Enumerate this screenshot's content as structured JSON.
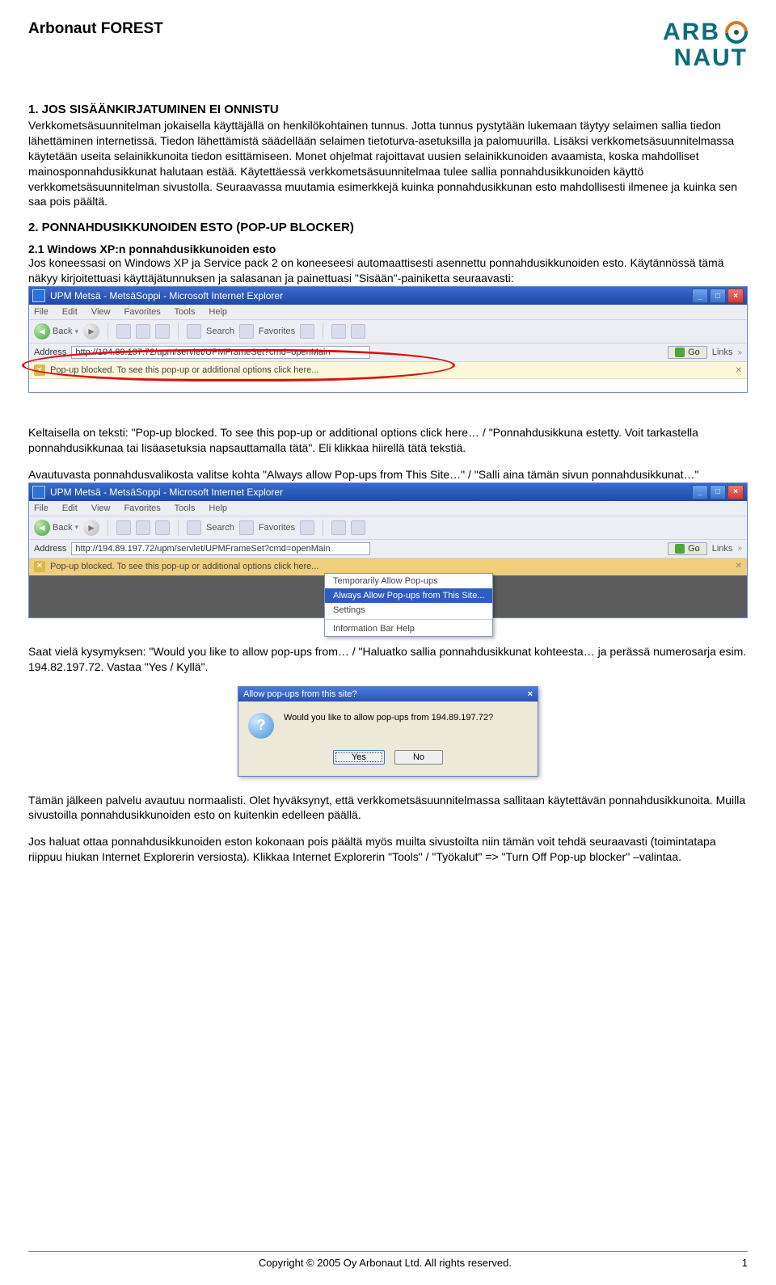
{
  "header": {
    "doc_title": "Arbonaut FOREST",
    "logo_top": "ARB",
    "logo_bottom": "NAUT"
  },
  "section1": {
    "title": "1. JOS SISÄÄNKIRJATUMINEN EI ONNISTU",
    "body": "Verkkometsäsuunnitelman jokaisella käyttäjällä on henkilökohtainen tunnus. Jotta tunnus pystytään lukemaan täytyy selaimen sallia tiedon lähettäminen internetissä. Tiedon lähettämistä säädellään selaimen tietoturva-asetuksilla ja palomuurilla. Lisäksi verkkometsäsuunnitelmassa käytetään useita selainikkunoita tiedon esittämiseen. Monet ohjelmat rajoittavat uusien selainikkunoiden avaamista, koska mahdolliset mainosponnahdusikkunat halutaan estää. Käytettäessä verkkometsäsuunnitelmaa tulee sallia ponnahdusikkunoiden käyttö verkkometsäsuunnitelman sivustolla. Seuraavassa muutamia esimerkkejä kuinka ponnahdusikkunan esto mahdollisesti ilmenee ja kuinka sen saa pois päältä."
  },
  "section2": {
    "title": "2. PONNAHDUSIKKUNOIDEN ESTO (POP-UP BLOCKER)",
    "sub_title": "2.1 Windows XP:n ponnahdusikkunoiden esto",
    "body": "Jos koneessasi on Windows XP ja Service pack 2 on koneeseesi automaattisesti asennettu ponnahdusikkunoiden esto. Käytännössä tämä näkyy kirjoitettuasi käyttäjätunnuksen ja salasanan ja painettuasi \"Sisään\"-painiketta seuraavasti:"
  },
  "ie_common": {
    "title": "UPM Metsä - MetsäSoppi - Microsoft Internet Explorer",
    "menu": {
      "file": "File",
      "edit": "Edit",
      "view": "View",
      "fav": "Favorites",
      "tools": "Tools",
      "help": "Help"
    },
    "toolbar": {
      "back": "Back",
      "search": "Search",
      "favorites": "Favorites"
    },
    "address_label": "Address",
    "url": "http://194.89.197.72/upm/servlet/UPMFrameSet?cmd=openMain",
    "go": "Go",
    "links": "Links",
    "popup_text": "Pop-up blocked. To see this pop-up or additional options click here..."
  },
  "popup_menu": {
    "item1": "Temporarily Allow Pop-ups",
    "item2": "Always Allow Pop-ups from This Site...",
    "item3": "Settings",
    "item4": "Information Bar Help"
  },
  "para_after_shot1": "Keltaisella on teksti: \"Pop-up blocked. To see this pop-up or additional options click here… / \"Ponnahdusikkuna estetty. Voit tarkastella ponnahdusikkunaa tai lisäasetuksia napsauttamalla tätä\". Eli klikkaa hiirellä tätä tekstiä.",
  "para_before_shot2": "Avautuvasta ponnahdusvalikosta valitse kohta \"Always allow Pop-ups from This Site…\" / \"Salli aina tämän sivun ponnahdusikkunat…\"",
  "para_after_shot2": "Saat vielä kysymyksen: \"Would you like to allow pop-ups from… / \"Haluatko sallia ponnahdusikkunat kohteesta… ja perässä numerosarja esim. 194.82.197.72. Vastaa \"Yes / Kyllä\".",
  "dialog": {
    "title": "Allow pop-ups from this site?",
    "body": "Would you like to allow pop-ups from 194.89.197.72?",
    "yes": "Yes",
    "no": "No"
  },
  "para_after_dialog": "Tämän jälkeen palvelu avautuu normaalisti. Olet hyväksynyt, että verkkometsäsuunnitelmassa sallitaan käytettävän ponnahdusikkunoita. Muilla sivustoilla ponnahdusikkunoiden esto on kuitenkin edelleen päällä.",
  "para_final": "Jos haluat ottaa ponnahdusikkunoiden eston kokonaan pois päältä myös muilta sivustoilta niin tämän voit tehdä seuraavasti (toimintatapa riippuu hiukan Internet Explorerin versiosta). Klikkaa Internet Explorerin \"Tools\" / \"Työkalut\" => \"Turn Off Pop-up blocker\" –valintaa.",
  "footer": {
    "copyright": "Copyright © 2005 Oy Arbonaut Ltd. All rights reserved.",
    "page": "1"
  }
}
